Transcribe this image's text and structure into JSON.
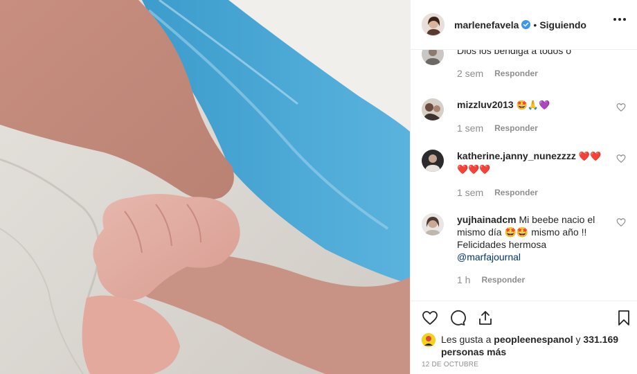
{
  "post": {
    "username": "marlenefavela",
    "separator": "•",
    "follow_state": "Siguiendo"
  },
  "comments": [
    {
      "username": "",
      "text": "Dios los bendiga a todos o",
      "time": "2 sem",
      "reply_label": "Responder"
    },
    {
      "username": "mizzluv2013",
      "text": "🤩🙏💜",
      "time": "1 sem",
      "reply_label": "Responder"
    },
    {
      "username": "katherine.janny_nunezzzz",
      "text": "❤️❤️ ❤️❤️❤️",
      "time": "1 sem",
      "reply_label": "Responder"
    },
    {
      "username": "yujhainadcm",
      "text_before": "Mi beebe nacio el mismo día 🤩🤩 mismo año !! Felicidades hermosa",
      "mention": "@marfajournal",
      "time": "1 h",
      "reply_label": "Responder"
    }
  ],
  "likes": {
    "prefix": "Les gusta a",
    "liker": "peopleenespanol",
    "connector": "y",
    "count_text": "331.169 personas más"
  },
  "date": "12 DE OCTUBRE",
  "colors": {
    "verified": "#3897f0",
    "muted": "#8e8e8e",
    "mention": "#00376b",
    "border": "#efefef"
  }
}
